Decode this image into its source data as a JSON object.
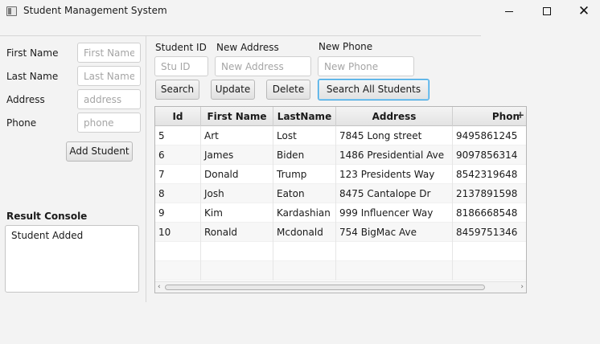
{
  "window": {
    "title": "Student Management System",
    "icon": "app-window-icon",
    "controls": {
      "minimize": "minimize-icon",
      "maximize": "maximize-icon",
      "close": "close-icon",
      "close_glyph": "✕"
    }
  },
  "form": {
    "first_name": {
      "label": "First Name",
      "placeholder": "First Name",
      "value": ""
    },
    "last_name": {
      "label": "Last Name",
      "placeholder": "Last Name",
      "value": ""
    },
    "address": {
      "label": "Address",
      "placeholder": "address",
      "value": ""
    },
    "phone": {
      "label": "Phone",
      "placeholder": "phone",
      "value": ""
    },
    "add_button": "Add Student"
  },
  "console": {
    "label": "Result Console",
    "text": "Student Added"
  },
  "search": {
    "student_id": {
      "label": "Student ID",
      "placeholder": "Stu ID",
      "value": ""
    },
    "new_address": {
      "label": "New Address",
      "placeholder": "New Address",
      "value": ""
    },
    "new_phone": {
      "label": "New Phone",
      "placeholder": "New Phone",
      "value": ""
    },
    "buttons": {
      "search": "Search",
      "update": "Update",
      "delete": "Delete",
      "search_all": "Search All Students"
    }
  },
  "table": {
    "columns": [
      "Id",
      "First Name",
      "LastName",
      "Address",
      "Phon"
    ],
    "column_menu": "+",
    "rows": [
      [
        "5",
        "Art",
        "Lost",
        "7845 Long street",
        "9495861245"
      ],
      [
        "6",
        "James",
        "Biden",
        "1486 Presidential Ave",
        "9097856314"
      ],
      [
        "7",
        "Donald",
        "Trump",
        "123 Presidents Way",
        "8542319648"
      ],
      [
        "8",
        "Josh",
        "Eaton",
        "8475 Cantalope Dr",
        "2137891598"
      ],
      [
        "9",
        "Kim",
        "Kardashian",
        "999 Influencer Way",
        "8186668548"
      ],
      [
        "10",
        "Ronald",
        "Mcdonald",
        "754 BigMac Ave",
        "8459751346"
      ]
    ],
    "scroll": {
      "left_arrow": "‹",
      "right_arrow": "›"
    }
  }
}
